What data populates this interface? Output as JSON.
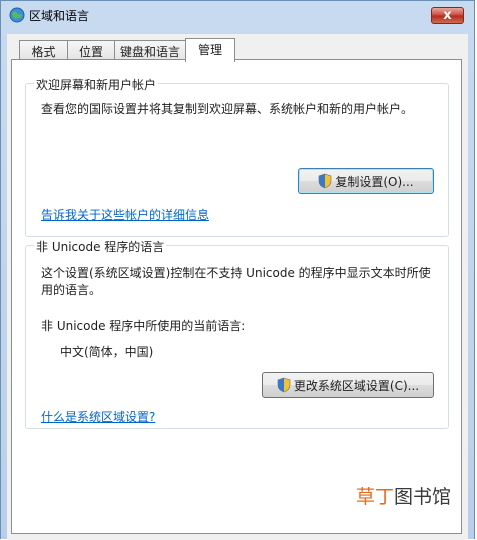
{
  "window": {
    "title": "区域和语言",
    "close_label": "x"
  },
  "tabs": [
    {
      "label": "格式"
    },
    {
      "label": "位置"
    },
    {
      "label": "键盘和语言"
    },
    {
      "label": "管理",
      "active": true
    }
  ],
  "welcome_group": {
    "label": "欢迎屏幕和新用户帐户",
    "description": "查看您的国际设置并将其复制到欢迎屏幕、系统帐户和新的用户帐户。",
    "copy_button": "复制设置(O)...",
    "link": "告诉我关于这些帐户的详细信息"
  },
  "unicode_group": {
    "label": "非 Unicode 程序的语言",
    "description_line1": "这个设置(系统区域设置)控制在不支持 Unicode 的程序中显示文本时所使",
    "description_line2": "用的语言。",
    "current_label": "非 Unicode 程序中所使用的当前语言:",
    "current_value": "中文(简体，中国)",
    "change_button": "更改系统区域设置(C)...",
    "link": "什么是系统区域设置?"
  },
  "watermark": {
    "part1": "草丁",
    "part2": "图书馆"
  }
}
